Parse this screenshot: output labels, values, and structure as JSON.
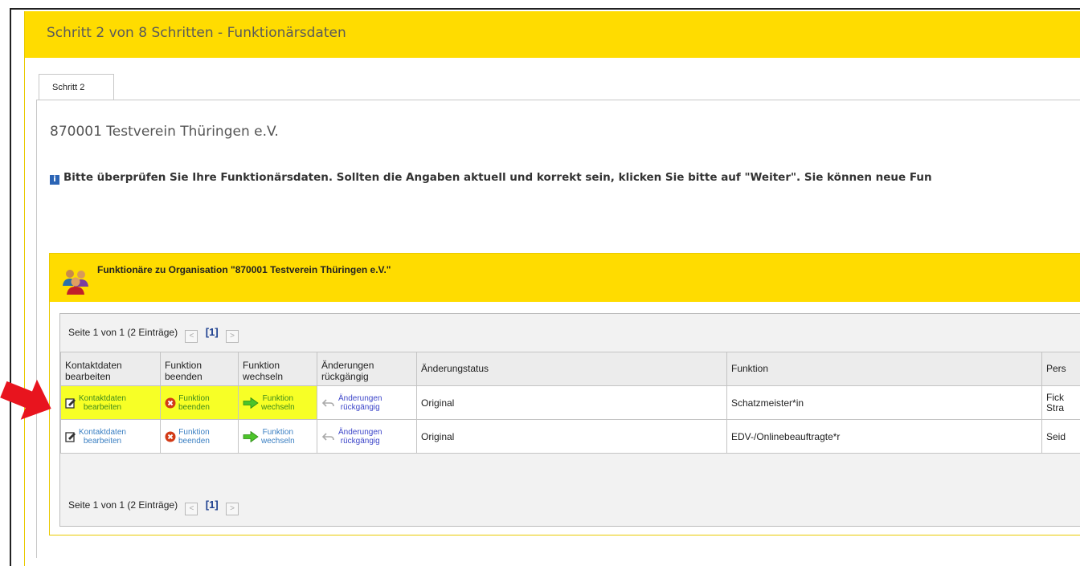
{
  "header": {
    "title": "Schritt 2 von 8 Schritten - Funktionärsdaten"
  },
  "tabs": [
    {
      "label": "Schritt 2"
    }
  ],
  "org_title": "870001 Testverein Thüringen e.V.",
  "info_text": "Bitte überprüfen Sie Ihre Funktionärsdaten. Sollten die Angaben aktuell und korrekt sein, klicken Sie bitte auf \"Weiter\". Sie können neue Fun",
  "section": {
    "title": "Funktionäre zu Organisation \"870001 Testverein Thüringen e.V.\""
  },
  "pager": {
    "text": "Seite 1 von 1 (2 Einträge)",
    "prev": "<",
    "next": ">",
    "current_page": "[1]"
  },
  "columns": {
    "kontaktdaten_1": "Kontaktdaten",
    "kontaktdaten_2": "bearbeiten",
    "funktion_beenden_1": "Funktion",
    "funktion_beenden_2": "beenden",
    "funktion_wechseln_1": "Funktion",
    "funktion_wechseln_2": "wechseln",
    "aenderungen_1": "Änderungen",
    "aenderungen_2": "rückgängig",
    "status": "Änderungstatus",
    "funktion": "Funktion",
    "person": "Pers"
  },
  "actions": {
    "edit_1": "Kontaktdaten",
    "edit_2": "bearbeiten",
    "end_1": "Funktion",
    "end_2": "beenden",
    "change_1": "Funktion",
    "change_2": "wechseln",
    "undo_1": "Änderungen",
    "undo_2": "rückgängig"
  },
  "rows": [
    {
      "status": "Original",
      "funktion": "Schatzmeister*in",
      "person_1": "Fick",
      "person_2": "Stra",
      "highlighted": true
    },
    {
      "status": "Original",
      "funktion": "EDV-/Onlinebeauftragte*r",
      "person_1": "Seid",
      "person_2": "",
      "highlighted": false
    }
  ],
  "colors": {
    "header_yellow": "#ffdc00",
    "highlight": "#f7ff26",
    "annotation_arrow": "#e8141e",
    "link_blue": "#3a7fc2"
  },
  "icons": {
    "info": "info-icon",
    "people": "people-group-icon",
    "edit": "edit-contact-icon",
    "end": "end-function-icon",
    "change": "change-function-icon",
    "undo": "undo-icon",
    "annotation": "red-arrow-icon"
  }
}
